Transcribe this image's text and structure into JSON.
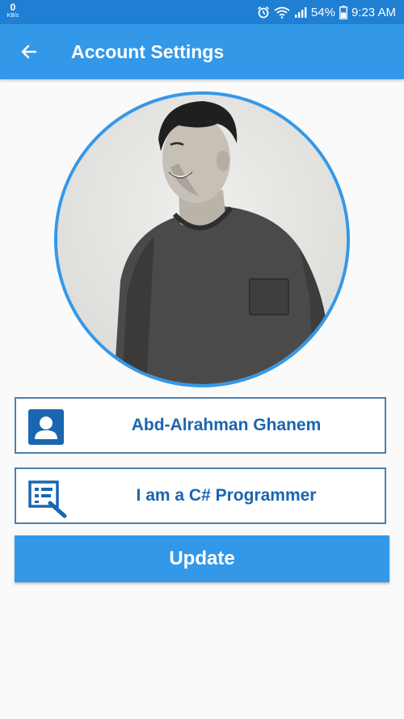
{
  "status_bar": {
    "speed_value": "0",
    "speed_unit": "KB/s",
    "battery": "54%",
    "time": "9:23 AM"
  },
  "app_bar": {
    "title": "Account Settings",
    "back_icon": "arrow-left-icon"
  },
  "profile": {
    "avatar_icon": "profile-photo"
  },
  "fields": {
    "name": {
      "value": "Abd-Alrahman Ghanem",
      "icon": "person-icon"
    },
    "bio": {
      "value": "I am a C# Programmer",
      "icon": "edit-form-icon"
    }
  },
  "actions": {
    "update_label": "Update"
  },
  "colors": {
    "status_bar": "#1f7fd3",
    "primary": "#3498e8",
    "field_text": "#1a66b0",
    "field_border": "#4e7fa8",
    "background": "#fafafa"
  }
}
